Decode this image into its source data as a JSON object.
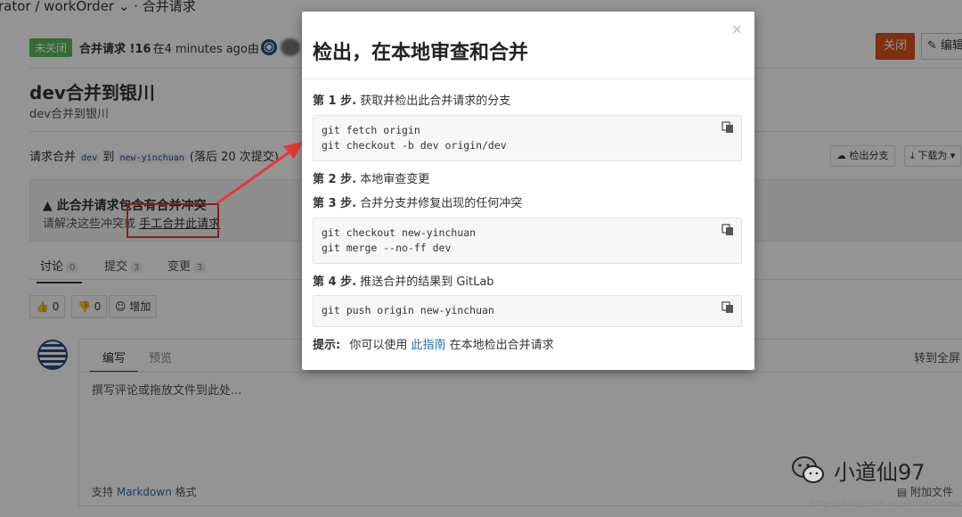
{
  "breadcrumb": {
    "text": "rator / workOrder ⌄ · 合并请求"
  },
  "status_line": {
    "badge": "未关闭",
    "mr_id": "合并请求 !16",
    "time_text": "在4 minutes ago由"
  },
  "header_buttons": {
    "close": "关闭",
    "edit": "编辑"
  },
  "merge_request": {
    "title": "dev合并到银川",
    "description": "dev合并到银川"
  },
  "branch_info": {
    "prefix": "请求合并",
    "source": "dev",
    "to": "到",
    "target": "new-yinchuan",
    "behind": "(落后 20 次提交)",
    "checkout_button": "检出分支",
    "download_button": "下载为"
  },
  "conflict": {
    "title": "此合并请求包含有合并冲突",
    "text_prefix": "请解决这些冲突或",
    "link": "手工合并此请求"
  },
  "tabs": [
    {
      "label": "讨论",
      "count": "0"
    },
    {
      "label": "提交",
      "count": "3"
    },
    {
      "label": "变更",
      "count": "3"
    }
  ],
  "reactions": {
    "thumbs_up": "0",
    "thumbs_down": "0",
    "add": "增加"
  },
  "comment": {
    "tab_write": "编写",
    "tab_preview": "预览",
    "fullscreen": "转到全屏",
    "placeholder": "撰写评论或拖放文件到此处...",
    "md_prefix": "支持",
    "md_link": "Markdown",
    "md_suffix": "格式",
    "attach": "附加文件"
  },
  "modal": {
    "title": "检出，在本地审查和合并",
    "close": "×",
    "step1_label": "第 1 步.",
    "step1_text": "获取并检出此合并请求的分支",
    "step1_code_1": "git fetch origin",
    "step1_code_2": "git checkout -b dev origin/dev",
    "step2_label": "第 2 步.",
    "step2_text": "本地审查变更",
    "step3_label": "第 3 步.",
    "step3_text": "合并分支并修复出现的任何冲突",
    "step3_code_1": "git checkout new-yinchuan",
    "step3_code_2": "git merge --no-ff dev",
    "step4_label": "第 4 步.",
    "step4_text": "推送合并的结果到 GitLab",
    "step4_code_1": "git push origin new-yinchuan",
    "hint_label": "提示:",
    "hint_prefix": "你可以使用",
    "hint_link": "此指南",
    "hint_suffix": "在本地检出合并请求"
  },
  "watermark": {
    "text": "小道仙97",
    "url": "https://blog.csdn.net/Tomwildboar"
  },
  "colors": {
    "accent_red": "#e53935",
    "close_btn": "#d9541e",
    "badge_green": "#5cb85c",
    "link_blue": "#2a6fa8"
  }
}
